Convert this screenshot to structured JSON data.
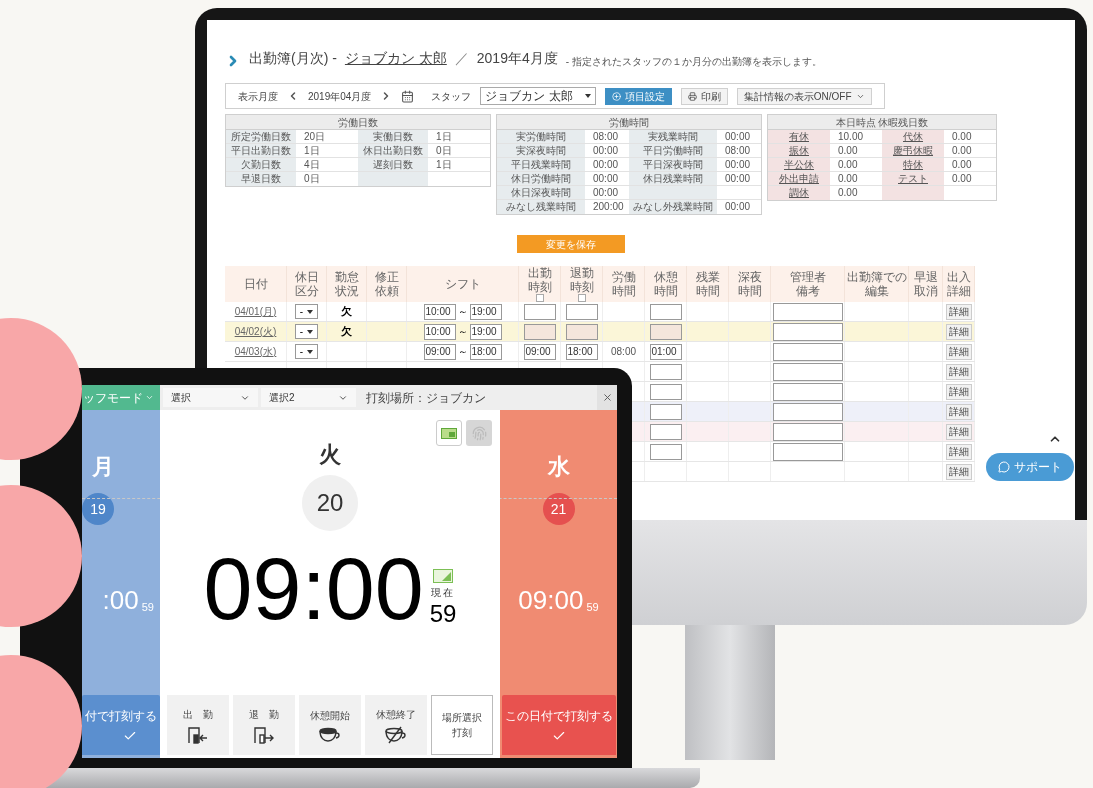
{
  "monitor": {
    "title": {
      "label": "出勤簿(月次) -",
      "staff": "ジョブカン 太郎",
      "separator": "／",
      "period": "2019年4月度",
      "description": "- 指定されたスタッフの１か月分の出勤簿を表示します。"
    },
    "toolbar": {
      "month_label": "表示月度",
      "month": "2019年04月度",
      "staff_label": "スタッフ",
      "staff": "ジョブカン 太郎",
      "buttons": [
        {
          "kind": "primary",
          "label": "項目設定"
        },
        {
          "kind": "print",
          "label": "印刷"
        },
        {
          "kind": "dropdown",
          "label": "集計情報の表示ON/OFF"
        }
      ]
    },
    "summary": [
      {
        "kind": "plain",
        "title": "労働日数",
        "rows": [
          [
            "所定労働日数",
            "20日",
            "実働日数",
            "1日"
          ],
          [
            "平日出勤日数",
            "1日",
            "休日出勤日数",
            "0日"
          ],
          [
            "欠勤日数",
            "4日",
            "遅刻日数",
            "1日"
          ],
          [
            "早退日数",
            "0日"
          ]
        ]
      },
      {
        "kind": "plain",
        "title": "労働時間",
        "rows": [
          [
            "実労働時間",
            "08:00",
            "実残業時間",
            "00:00"
          ],
          [
            "実深夜時間",
            "00:00",
            "平日労働時間",
            "08:00"
          ],
          [
            "平日残業時間",
            "00:00",
            "平日深夜時間",
            "00:00"
          ],
          [
            "休日労働時間",
            "00:00",
            "休日残業時間",
            "00:00"
          ],
          [
            "休日深夜時間",
            "00:00"
          ],
          [
            "みなし残業時間",
            "200:00",
            "みなし外残業時間",
            "00:00"
          ]
        ]
      },
      {
        "kind": "leave",
        "title": "本日時点 休暇残日数",
        "rows": [
          [
            "有休",
            "10.00",
            "代休",
            "0.00"
          ],
          [
            "振休",
            "0.00",
            "慶弔休暇",
            "0.00"
          ],
          [
            "半公休",
            "0.00",
            "特休",
            "0.00"
          ],
          [
            "外出申請",
            "0.00",
            "テスト",
            "0.00"
          ],
          [
            "調休",
            "0.00"
          ]
        ]
      }
    ],
    "save_button": "変更を保存",
    "table": {
      "columns": [
        {
          "label": "日付"
        },
        {
          "label": "休日区分"
        },
        {
          "label": "勤怠状況"
        },
        {
          "label": "修正依頼"
        },
        {
          "label": "シフト"
        },
        {
          "label": "出勤時刻",
          "checkbox": {
            "checked": false
          }
        },
        {
          "label": "退勤時刻",
          "checkbox": {
            "checked": false
          }
        },
        {
          "label": "労働時間"
        },
        {
          "label": "休憩時間"
        },
        {
          "label": "残業時間"
        },
        {
          "label": "深夜時間"
        },
        {
          "label": "管理者備考"
        },
        {
          "label": "出勤簿での編集"
        },
        {
          "label": "早退取消"
        },
        {
          "label": "出入詳細"
        }
      ],
      "rows": [
        {
          "color": "#ffffff",
          "date": "04/01(月)",
          "holiday": "-",
          "status": "欠",
          "shift": [
            "10:00",
            "～",
            "19:00"
          ],
          "fields": {
            "clock_in": true,
            "clock_out": true,
            "break": true,
            "memo": true
          },
          "fields_disabled": false,
          "detail": "詳細"
        },
        {
          "color": "#fbf6d8",
          "date": "04/02(火)",
          "holiday": "-",
          "status": "欠",
          "shift": [
            "10:00",
            "～",
            "19:00"
          ],
          "fields": {
            "clock_in": true,
            "clock_out": true,
            "break": true,
            "memo": true
          },
          "fields_disabled": true,
          "detail": "詳細"
        },
        {
          "color": "#ffffff",
          "date": "04/03(水)",
          "holiday": "-",
          "shift": [
            "09:00",
            "～",
            "18:00"
          ],
          "fields": {
            "clock_in": true,
            "clock_out": true,
            "break": true,
            "memo": true
          },
          "clock_in": "09:00",
          "clock_out": "18:00",
          "work": "08:00",
          "break": "01:00",
          "fields_disabled": false,
          "detail": "詳細"
        },
        {
          "color": "#ffffff",
          "fields": {
            "break": true,
            "memo": true
          },
          "fields_disabled": false,
          "detail": "詳細"
        },
        {
          "color": "#ffffff",
          "fields": {
            "break": true,
            "memo": true
          },
          "fields_disabled": false,
          "detail": "詳細"
        },
        {
          "color": "#eef0f9",
          "fields": {
            "break": true,
            "memo": true
          },
          "fields_disabled": false,
          "detail": "詳細"
        },
        {
          "color": "#fbeff1",
          "fields": {
            "break": true,
            "memo": true
          },
          "fields_disabled": false,
          "detail": "詳細"
        },
        {
          "color": "#ffffff",
          "fields": {
            "break": true,
            "memo": true
          },
          "fields_disabled": false,
          "detail": "詳細"
        },
        {
          "color": "#ffffff",
          "fields": {
            "break": false,
            "memo": false
          },
          "detail": "詳細"
        }
      ]
    },
    "support_button": "サポート"
  },
  "laptop": {
    "mode_menu": "ッフモード",
    "selects": [
      "選択",
      "選択2"
    ],
    "location": "打刻場所：ジョブカン",
    "auth_buttons": [
      {
        "kind": "card",
        "selected": true
      },
      {
        "kind": "fingerprint",
        "selected": false
      }
    ],
    "days": [
      {
        "kind": "past",
        "weekday": "月",
        "date": "19",
        "time": ":00",
        "seconds": "59",
        "button": "付で打刻する"
      },
      {
        "kind": "today",
        "weekday": "火",
        "date": "20",
        "time": "09:00",
        "now_label": "現在",
        "seconds": "59"
      },
      {
        "kind": "next",
        "weekday": "水",
        "date": "21",
        "time": "09:00",
        "seconds": "59",
        "button": "この日付で打刻する"
      }
    ],
    "actions": [
      {
        "kind": "enter",
        "label": "出　勤"
      },
      {
        "kind": "exit",
        "label": "退　勤"
      },
      {
        "kind": "cup",
        "label": "休憩開始"
      },
      {
        "kind": "cup-off",
        "label": "休憩終了"
      },
      {
        "kind": "outline",
        "label": "場所選択打刻"
      }
    ]
  }
}
